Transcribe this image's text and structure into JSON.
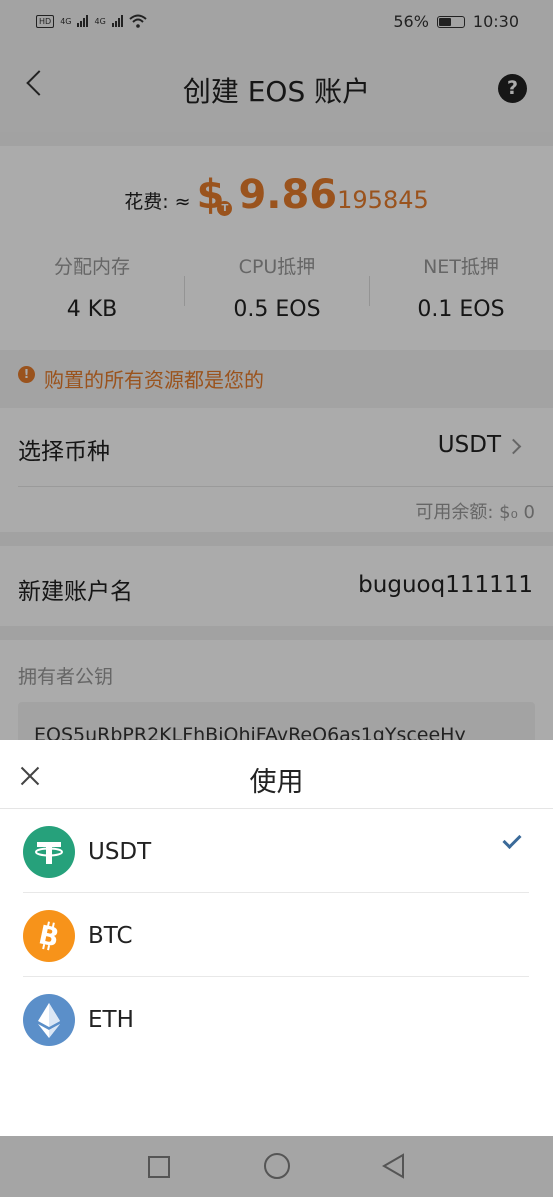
{
  "status_bar": {
    "hd": "HD",
    "net1": "4G",
    "net2": "4G",
    "battery_percent": "56%",
    "battery_level": 0.56,
    "time": "10:30"
  },
  "header": {
    "title": "创建 EOS 账户",
    "help_glyph": "?"
  },
  "cost": {
    "label": "花费: ≈",
    "currency_symbol": "$",
    "token_badge": "T",
    "amount_main": "9.86",
    "amount_sub": "195845"
  },
  "resources": [
    {
      "label": "分配内存",
      "value": "4 KB"
    },
    {
      "label": "CPU抵押",
      "value": "0.5 EOS"
    },
    {
      "label": "NET抵押",
      "value": "0.1 EOS"
    }
  ],
  "warning": {
    "icon_glyph": "!",
    "text": "购置的所有资源都是您的"
  },
  "currency_select": {
    "label": "选择币种",
    "value": "USDT",
    "balance": "可用余额: $₀ 0"
  },
  "account": {
    "label": "新建账户名",
    "value": "buguoq111111"
  },
  "owner_key": {
    "label": "拥有者公钥",
    "value": "EOS5uRbPR2KLFhBiQhiFAvReQ6as1gYsceeHy"
  },
  "sheet": {
    "title": "使用",
    "coins": [
      {
        "name": "USDT",
        "icon": "tether-icon",
        "color": "#26a17b",
        "selected": true
      },
      {
        "name": "BTC",
        "icon": "bitcoin-icon",
        "color": "#f7931a",
        "selected": false
      },
      {
        "name": "ETH",
        "icon": "ethereum-icon",
        "color": "#5b8fc9",
        "selected": false
      }
    ]
  },
  "colors": {
    "accent": "#e67c2c",
    "check": "#3b6a99"
  }
}
